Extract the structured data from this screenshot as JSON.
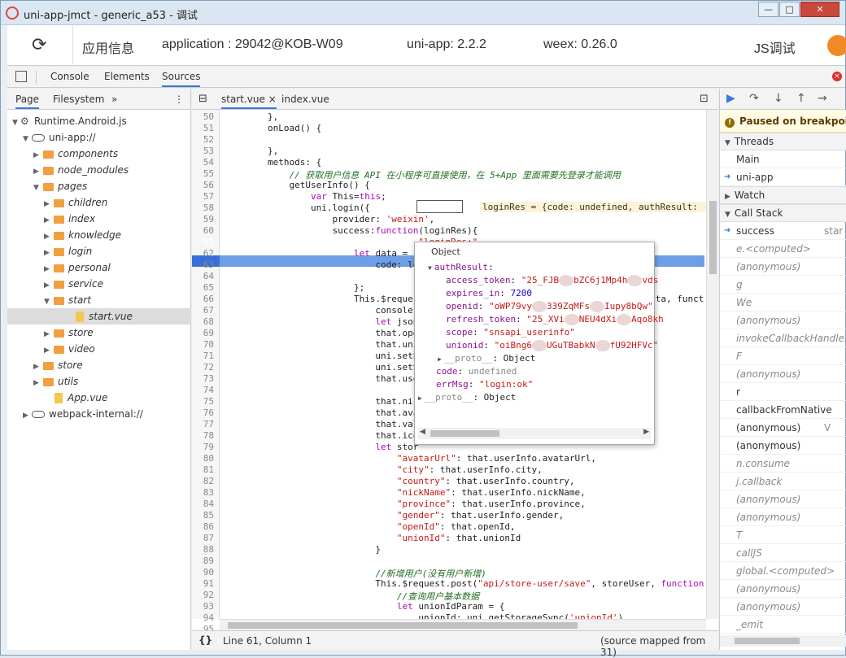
{
  "window": {
    "title": "uni-app-jmct - generic_a53 - 调试",
    "buttons": [
      "—",
      "□",
      "✕"
    ]
  },
  "appbar": {
    "app_info": "应用信息",
    "application": "application : 29042@KOB-W09",
    "uniapp": "uni-app: 2.2.2",
    "weex": "weex: 0.26.0",
    "js_debug": "JS调试"
  },
  "devtools": {
    "tabs": [
      "Console",
      "Elements",
      "Sources"
    ],
    "active_tab": "Sources"
  },
  "navigator": {
    "tabs": [
      "Page",
      "Filesystem"
    ],
    "more": "»",
    "menu": "⋮",
    "tree": [
      {
        "label": "Runtime.Android.js",
        "depth": 0,
        "type": "gear",
        "open": true
      },
      {
        "label": "uni-app://",
        "depth": 1,
        "type": "cloud",
        "open": true
      },
      {
        "label": "components",
        "depth": 2,
        "type": "folder",
        "open": false
      },
      {
        "label": "node_modules",
        "depth": 2,
        "type": "folder",
        "open": false
      },
      {
        "label": "pages",
        "depth": 2,
        "type": "folder",
        "open": true
      },
      {
        "label": "children",
        "depth": 3,
        "type": "folder",
        "open": false
      },
      {
        "label": "index",
        "depth": 3,
        "type": "folder",
        "open": false
      },
      {
        "label": "knowledge",
        "depth": 3,
        "type": "folder",
        "open": false
      },
      {
        "label": "login",
        "depth": 3,
        "type": "folder",
        "open": false
      },
      {
        "label": "personal",
        "depth": 3,
        "type": "folder",
        "open": false
      },
      {
        "label": "service",
        "depth": 3,
        "type": "folder",
        "open": false
      },
      {
        "label": "start",
        "depth": 3,
        "type": "folder",
        "open": true
      },
      {
        "label": "start.vue",
        "depth": 5,
        "type": "file",
        "selected": true
      },
      {
        "label": "store",
        "depth": 3,
        "type": "folder",
        "open": false
      },
      {
        "label": "video",
        "depth": 3,
        "type": "folder",
        "open": false
      },
      {
        "label": "store",
        "depth": 2,
        "type": "folder",
        "open": false
      },
      {
        "label": "utils",
        "depth": 2,
        "type": "folder",
        "open": false
      },
      {
        "label": "App.vue",
        "depth": 3,
        "type": "file"
      },
      {
        "label": "webpack-internal://",
        "depth": 1,
        "type": "cloud",
        "open": false
      }
    ]
  },
  "editor": {
    "tabs": [
      {
        "label": "start.vue",
        "close": "×"
      },
      {
        "label": "index.vue"
      }
    ],
    "current_line": 61,
    "inline_hint": "loginRes = {code: undefined, authResult: ",
    "lines": [
      {
        "n": 50,
        "html": "        },"
      },
      {
        "n": 51,
        "html": "        onLoad() {"
      },
      {
        "n": 52,
        "html": ""
      },
      {
        "n": 53,
        "html": "        },"
      },
      {
        "n": 54,
        "html": "        methods: {"
      },
      {
        "n": 55,
        "html": "            <span class=\"cm\">// 获取用户信息 API 在小程序可直接使用，在 5+App 里面需要先登录才能调用</span>"
      },
      {
        "n": 56,
        "html": "            getUserInfo() {"
      },
      {
        "n": 57,
        "html": "                <span class=\"kw\">var</span> This=<span class=\"kw\">this</span>;"
      },
      {
        "n": 58,
        "html": "                uni.login({"
      },
      {
        "n": 59,
        "html": "                    provider: <span class=\"str\">'weixin'</span>,"
      },
      {
        "n": 60,
        "html": "                    success:<span class=\"kw\">function</span>(loginRes){"
      },
      {
        "n": 61,
        "html": "                        console.log(<span class=\"str\">\"loginRes:\"</span>+loginRes.code)"
      },
      {
        "n": 62,
        "html": "                        <span class=\"kw\">let</span> data = {"
      },
      {
        "n": 63,
        "html": "                            code: lo"
      },
      {
        "n": 64,
        "html": ""
      },
      {
        "n": 65,
        "html": "                        };"
      },
      {
        "n": 66,
        "html": "                        This.$request                                          ata, funct"
      },
      {
        "n": 67,
        "html": "                            console."
      },
      {
        "n": 68,
        "html": "                            <span class=\"kw\">let</span> json"
      },
      {
        "n": 69,
        "html": "                            that.ope"
      },
      {
        "n": 70,
        "html": "                            that.uni"
      },
      {
        "n": 71,
        "html": "                            uni.setS"
      },
      {
        "n": 72,
        "html": "                            uni.setS"
      },
      {
        "n": 73,
        "html": "                            that.use"
      },
      {
        "n": 74,
        "html": ""
      },
      {
        "n": 75,
        "html": "                            that.nic"
      },
      {
        "n": 76,
        "html": "                            that.ava"
      },
      {
        "n": 77,
        "html": "                            that.val"
      },
      {
        "n": 78,
        "html": "                            that.ico"
      },
      {
        "n": 79,
        "html": "                            <span class=\"kw\">let</span> stor"
      },
      {
        "n": 80,
        "html": "                                <span class=\"str\">\"avatarUrl\"</span>: that.userInfo.avatarUrl,"
      },
      {
        "n": 81,
        "html": "                                <span class=\"str\">\"city\"</span>: that.userInfo.city,"
      },
      {
        "n": 82,
        "html": "                                <span class=\"str\">\"country\"</span>: that.userInfo.country,"
      },
      {
        "n": 83,
        "html": "                                <span class=\"str\">\"nickName\"</span>: that.userInfo.nickName,"
      },
      {
        "n": 84,
        "html": "                                <span class=\"str\">\"province\"</span>: that.userInfo.province,"
      },
      {
        "n": 85,
        "html": "                                <span class=\"str\">\"gender\"</span>: that.userInfo.gender,"
      },
      {
        "n": 86,
        "html": "                                <span class=\"str\">\"openId\"</span>: that.openId,"
      },
      {
        "n": 87,
        "html": "                                <span class=\"str\">\"unionId\"</span>: that.unionId"
      },
      {
        "n": 88,
        "html": "                            }"
      },
      {
        "n": 89,
        "html": ""
      },
      {
        "n": 90,
        "html": "                            <span class=\"cm\">//新增用户(没有用户新增)</span>"
      },
      {
        "n": 91,
        "html": "                            This.$request.post(<span class=\"str\">\"api/store-user/save\"</span>, storeUser, <span class=\"kw\">function</span>(r"
      },
      {
        "n": 92,
        "html": "                                <span class=\"cm\">//查询用户基本数据</span>"
      },
      {
        "n": 93,
        "html": "                                <span class=\"kw\">let</span> unionIdParam = {"
      },
      {
        "n": 94,
        "html": "                                    unionId: uni.getStorageSync(<span class=\"str\">'unionId'</span>)"
      },
      {
        "n": 95,
        "html": "                                }"
      }
    ],
    "status_position": "Line 61, Column 1",
    "status_source": "(source mapped from 31)",
    "status_icon": "{}"
  },
  "popover": {
    "header": "Object",
    "lines": [
      {
        "indent": 0,
        "tri": "▼",
        "html": "<span class=\"key\">authResult</span>:"
      },
      {
        "indent": 1,
        "html": "<span class=\"key\">access_token</span>: <span class=\"sv\">\"25_FJB<i class=\"blur\"></i>bZC6j1Mp4h<i class=\"blur\"></i>vds</span>"
      },
      {
        "indent": 1,
        "html": "<span class=\"key\">expires_in</span>: <span class=\"nv\">7200</span>"
      },
      {
        "indent": 1,
        "html": "<span class=\"key\">openid</span>: <span class=\"sv\">\"oWP79vy<i class=\"blur\"></i>339ZqMFs<i class=\"blur\"></i>Iupy8bQw\"</span>"
      },
      {
        "indent": 1,
        "html": "<span class=\"key\">refresh_token</span>: <span class=\"sv\">\"25_XVi<i class=\"blur\"></i>NEU4dXi<i class=\"blur\"></i>Aqo8kh</span>"
      },
      {
        "indent": 1,
        "html": "<span class=\"key\">scope</span>: <span class=\"sv\">\"snsapi_userinfo\"</span>"
      },
      {
        "indent": 1,
        "html": "<span class=\"key\">unionid</span>: <span class=\"sv\">\"oiBng6<i class=\"blur\"></i>UGuTBabkN<i class=\"blur\"></i>fU92HFVc\"</span>"
      },
      {
        "indent": 1,
        "tri": "▶",
        "html": "<span class=\"key\" style=\"color:#888\">__proto__</span>: Object"
      },
      {
        "indent": 0,
        "html": "<span class=\"key\">code</span>: <span style=\"color:#888\">undefined</span>"
      },
      {
        "indent": 0,
        "html": "<span class=\"key\">errMsg</span>: <span class=\"sv\">\"login:ok\"</span>"
      },
      {
        "indent": -1,
        "tri": "▶",
        "html": "<span class=\"key\" style=\"color:#888\">__proto__</span>: Object"
      }
    ]
  },
  "sidebar": {
    "paused": "Paused on breakpoint",
    "threads_header": "Threads",
    "threads": [
      "Main",
      "uni-app"
    ],
    "watch_header": "Watch",
    "callstack_header": "Call Stack",
    "callstack": [
      {
        "name": "success",
        "loc": "star",
        "current": true
      },
      {
        "name": "e.<computed>",
        "italic": true
      },
      {
        "name": "(anonymous)",
        "italic": true
      },
      {
        "name": "g",
        "italic": true
      },
      {
        "name": "We",
        "italic": true
      },
      {
        "name": "(anonymous)",
        "italic": true
      },
      {
        "name": "invokeCallbackHandler",
        "italic": true
      },
      {
        "name": "F",
        "italic": true
      },
      {
        "name": "(anonymous)",
        "italic": true
      },
      {
        "name": "r"
      },
      {
        "name": "callbackFromNative"
      },
      {
        "name": "(anonymous)",
        "loc": "V"
      },
      {
        "name": "(anonymous)"
      },
      {
        "name": "n.consume",
        "italic": true
      },
      {
        "name": "j.callback",
        "italic": true
      },
      {
        "name": "(anonymous)",
        "italic": true
      },
      {
        "name": "(anonymous)",
        "italic": true
      },
      {
        "name": "T",
        "italic": true
      },
      {
        "name": "callJS",
        "italic": true
      },
      {
        "name": "global.<computed>",
        "italic": true
      },
      {
        "name": "(anonymous)",
        "italic": true
      },
      {
        "name": "(anonymous)",
        "italic": true
      },
      {
        "name": "_emit",
        "italic": true
      }
    ]
  }
}
